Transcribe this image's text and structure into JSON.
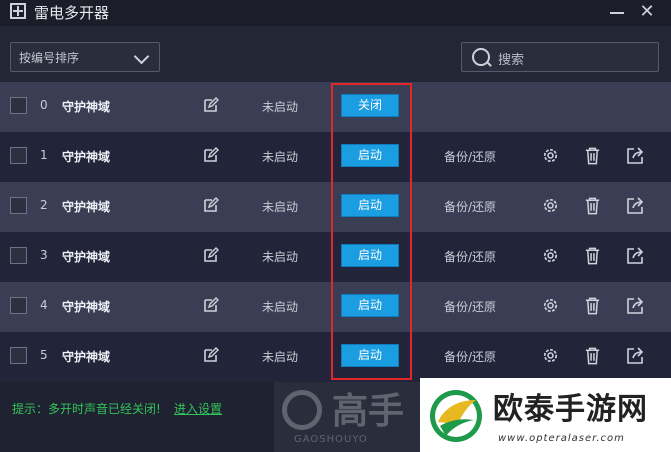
{
  "window": {
    "title": "雷电多开器"
  },
  "toolbar": {
    "sort_value": "按编号排序",
    "search_placeholder": "搜索"
  },
  "instances": [
    {
      "index": "0",
      "name": "守护神域",
      "status": "未启动",
      "action": "关闭",
      "backup": ""
    },
    {
      "index": "1",
      "name": "守护神域",
      "status": "未启动",
      "action": "启动",
      "backup": "备份/还原"
    },
    {
      "index": "2",
      "name": "守护神域",
      "status": "未启动",
      "action": "启动",
      "backup": "备份/还原"
    },
    {
      "index": "3",
      "name": "守护神域",
      "status": "未启动",
      "action": "启动",
      "backup": "备份/还原"
    },
    {
      "index": "4",
      "name": "守护神域",
      "status": "未启动",
      "action": "启动",
      "backup": "备份/还原"
    },
    {
      "index": "5",
      "name": "守护神域",
      "status": "未启动",
      "action": "启动",
      "backup": "备份/还原"
    }
  ],
  "footer": {
    "tip": "提示：多开时声音已经关闭!",
    "link": "进入设置"
  },
  "watermarks": {
    "gaoshou_text": "高手",
    "gaoshou_sub": "GAOSHOUYO",
    "otai_text": "欧泰手游网",
    "otai_url": "www.opteralaser.com"
  },
  "colors": {
    "accent_button": "#1b9de2",
    "highlight_border": "#e3262a",
    "tip_green": "#33c35b"
  }
}
